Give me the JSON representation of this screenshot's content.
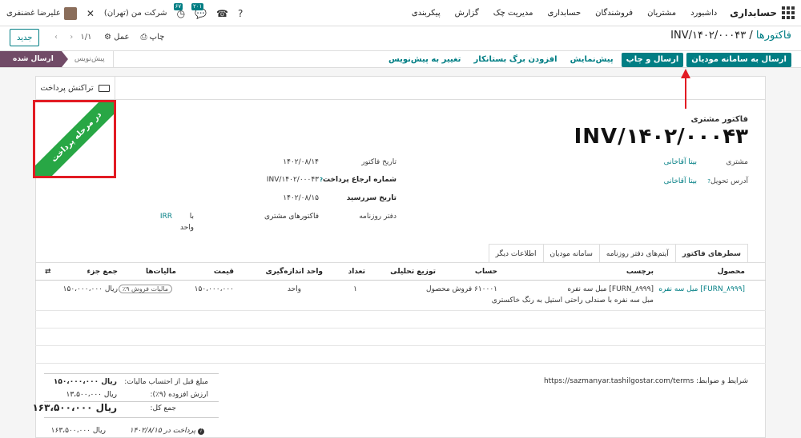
{
  "navbar": {
    "brand": "حسابداری",
    "menu": [
      "داشبورد",
      "مشتریان",
      "فروشندگان",
      "حسابداری",
      "مدیریت چک",
      "گزارش",
      "پیکربندی"
    ],
    "company": "شرکت من (تهران)",
    "user": "علیرضا غضنفری",
    "badge_chat": "۲۰۱",
    "badge_activity": "۶۷"
  },
  "control": {
    "breadcrumb_parent": "فاکتورها",
    "breadcrumb_sep": "/",
    "breadcrumb_current": "INV/۱۴۰۲/۰۰۰۴۳",
    "new_label": "جدید",
    "pager": "۱/۱",
    "print_label": "چاپ",
    "action_label": "عمل"
  },
  "statusbar": {
    "buttons": {
      "send_to_tax": "ارسال به سامانه مودیان",
      "send_print": "ارسال و چاپ",
      "preview": "پیش‌نمایش",
      "add_form": "افزودن برگ بستانکار",
      "to_draft": "تغییر به پیش‌نویس"
    },
    "stages": {
      "sent": "ارسال شده",
      "draft": "پیش‌نویس"
    }
  },
  "smart": {
    "payment_tx": "تراکنش پرداخت"
  },
  "ribbon": {
    "text": "در مرحله پرداخت"
  },
  "header": {
    "doc_type": "فاکتور مشتری",
    "number": "INV/۱۴۰۲/۰۰۰۴۳",
    "customer_label": "مشتری",
    "customer": "بیتا آقاخانی",
    "delivery_label": "آدرس تحویل",
    "delivery": "بیتا آقاخانی",
    "invoice_date_label": "تاریخ فاکتور",
    "invoice_date": "۱۴۰۲/۰۸/۱۴",
    "payment_ref_label": "شماره ارجاع پرداخت",
    "payment_ref": "INV/۱۴۰۲/۰۰۰۴۳",
    "due_date_label": "تاریخ سررسید",
    "due_date": "۱۴۰۲/۰۸/۱۵",
    "journal_label": "دفتر روزنامه",
    "journal": "فاکتورهای مشتری",
    "journal_in": "با",
    "currency": "IRR",
    "currency_unit": "واحد"
  },
  "tabs": [
    "سطرهای فاکتور",
    "آیتم‌های دفتر روزنامه",
    "سامانه مودیان",
    "اطلاعات دیگر"
  ],
  "table": {
    "headers": {
      "product": "محصول",
      "label": "برچسب",
      "account": "حساب",
      "analytic": "توزیع تحلیلی",
      "qty": "تعداد",
      "uom": "واحد اندازه‌گیری",
      "price": "قیمت",
      "taxes": "مالیات‌ها",
      "subtotal": "جمع جزء"
    },
    "rows": [
      {
        "product": "[FURN_۸۹۹۹] میل سه نفره",
        "label_line1": "[FURN_۸۹۹۹] مبل سه نفره",
        "label_line2": "مبل سه نفره با صندلی راحتی استیل به رنگ خاکستری",
        "account": "۶۱۰۰۰۱ فروش محصول",
        "qty": "۱",
        "uom": "واحد",
        "price": "۱۵۰،۰۰۰،۰۰۰",
        "tax": "مالیات فروش ۹٪",
        "subtotal": "ریال ۱۵۰،۰۰۰،۰۰۰"
      }
    ]
  },
  "terms": "شرایط و ضوابط: https://sazmanyar.tashilgostar.com/terms",
  "totals": {
    "untaxed_label": "مبلغ قبل از احتساب مالیات:",
    "untaxed": "ریال ۱۵۰،۰۰۰،۰۰۰",
    "vat_label": "ارزش افزوده (۹٪):",
    "vat": "ریال ۱۳،۵۰۰،۰۰۰",
    "total_label": "جمع کل:",
    "total": "ریال ۱۶۳،۵۰۰،۰۰۰",
    "paid_label": "پرداخت در ۱۴۰۲/۸/۱۵",
    "paid": "ریال ۱۶۳،۵۰۰،۰۰۰"
  }
}
